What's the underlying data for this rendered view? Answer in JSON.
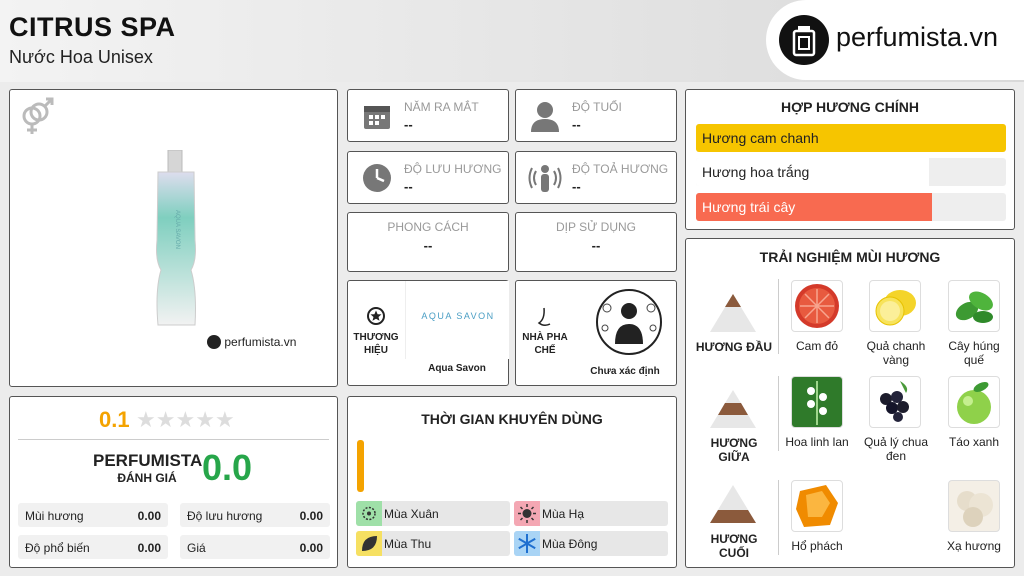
{
  "header": {
    "title": "CITRUS SPA",
    "subtitle": "Nước Hoa Unisex",
    "logo_text": "perfumista.vn"
  },
  "product": {
    "gender_icon": "gender-unisex-icon",
    "watermark": "perfumista.vn",
    "bottle_text": "AQUA SAVON"
  },
  "info": {
    "release_label": "NĂM RA MẮT",
    "release_value": "--",
    "age_label": "ĐỘ TUỔI",
    "age_value": "--",
    "longevity_label": "ĐỘ LƯU HƯƠNG",
    "longevity_value": "--",
    "sillage_label": "ĐỘ TOẢ HƯƠNG",
    "sillage_value": "--",
    "style_label": "PHONG CÁCH",
    "style_value": "--",
    "occasion_label": "DỊP SỬ DỤNG",
    "occasion_value": "--",
    "brand_label": "THƯƠNG HIỆU",
    "brand_logo_text": "AQUA SAVON",
    "brand_logo_sub": "SAVON",
    "brand_name": "Aqua Savon",
    "perfumer_label": "NHÀ PHA CHẾ",
    "perfumer_name": "Chưa xác định"
  },
  "accords": {
    "title": "HỢP HƯƠNG CHÍNH",
    "items": [
      {
        "label": "Hương cam chanh",
        "value": 100,
        "color": "#f6c500"
      },
      {
        "label": "Hương hoa trắng",
        "value": 75,
        "color": "#ffffff"
      },
      {
        "label": "Hương trái cây",
        "value": 76,
        "color": "#f86a50"
      }
    ]
  },
  "notes": {
    "title": "TRẢI NGHIỆM MÙI HƯƠNG",
    "top_label": "HƯƠNG ĐẦU",
    "middle_label": "HƯƠNG GIỮA",
    "base_label": "HƯƠNG CUỐI",
    "top": [
      {
        "label": "Cam đỏ",
        "icon": "blood-orange-icon"
      },
      {
        "label": "Quả chanh vàng",
        "icon": "lemon-icon"
      },
      {
        "label": "Cây húng quế",
        "icon": "basil-icon"
      }
    ],
    "middle": [
      {
        "label": "Hoa linh lan",
        "icon": "lily-of-the-valley-icon"
      },
      {
        "label": "Quả lý chua đen",
        "icon": "black-currant-icon"
      },
      {
        "label": "Táo xanh",
        "icon": "green-apple-icon"
      }
    ],
    "base": [
      {
        "label": "Hổ phách",
        "icon": "amber-icon"
      },
      {
        "label": "Xạ hương",
        "icon": "musk-icon"
      }
    ]
  },
  "rating": {
    "score": "0.1",
    "stars_filled": 0,
    "stars_total": 5,
    "brand": "PERFUMISTA",
    "caption": "ĐÁNH GIÁ",
    "big_score": "0.0",
    "rows": [
      {
        "label": "Mùi hương",
        "value": "0.00"
      },
      {
        "label": "Độ lưu hương",
        "value": "0.00"
      },
      {
        "label": "Độ phổ biến",
        "value": "0.00"
      },
      {
        "label": "Giá",
        "value": "0.00"
      }
    ]
  },
  "season": {
    "title": "THỜI GIAN KHUYÊN DÙNG",
    "spring": "Mùa Xuân",
    "summer": "Mùa Hạ",
    "autumn": "Mùa Thu",
    "winter": "Mùa Đông",
    "colors": {
      "accent": "#f4a300",
      "spring": "#9fe0a8",
      "summer": "#f4a7b3",
      "autumn": "#f6e062",
      "winter": "#a9d4f5"
    }
  }
}
